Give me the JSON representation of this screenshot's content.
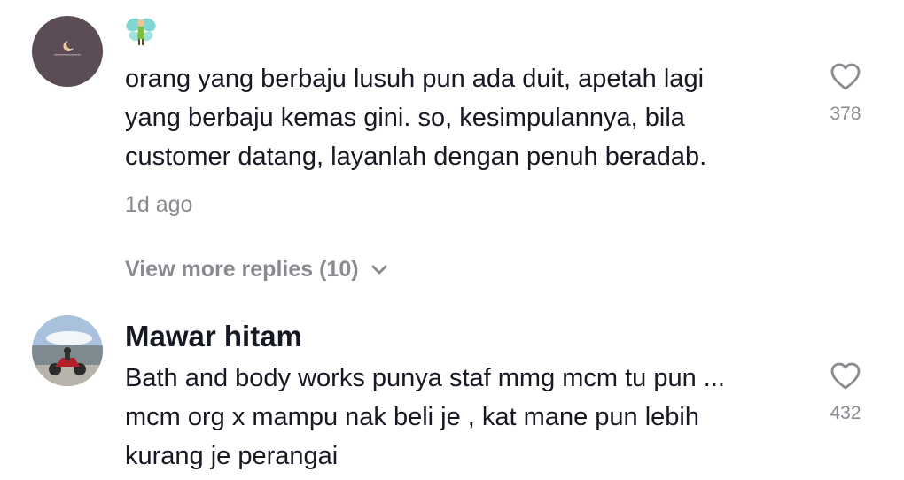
{
  "comments": [
    {
      "username": "",
      "avatar_icon": "crescent-moon-avatar",
      "emoji_icon": "fairy-emoji",
      "lines": [
        "orang yang berbaju lusuh pun ada duit, apetah lagi",
        "yang berbaju kemas gini. so, kesimpulannya, bila",
        "customer datang, layanlah dengan penuh beradab."
      ],
      "time": "1d ago",
      "likes": "378",
      "view_more": "View more replies (10)"
    },
    {
      "username": "Mawar hitam",
      "avatar_icon": "motorbike-photo-avatar",
      "lines": [
        "Bath and body works punya staf mmg mcm tu pun ...",
        "mcm org x mampu nak beli je , kat mane pun lebih",
        "kurang je perangai"
      ],
      "likes": "432"
    }
  ],
  "colors": {
    "text": "#161823",
    "muted": "#8a8b91",
    "avatar1_bg": "#5b4c55"
  }
}
